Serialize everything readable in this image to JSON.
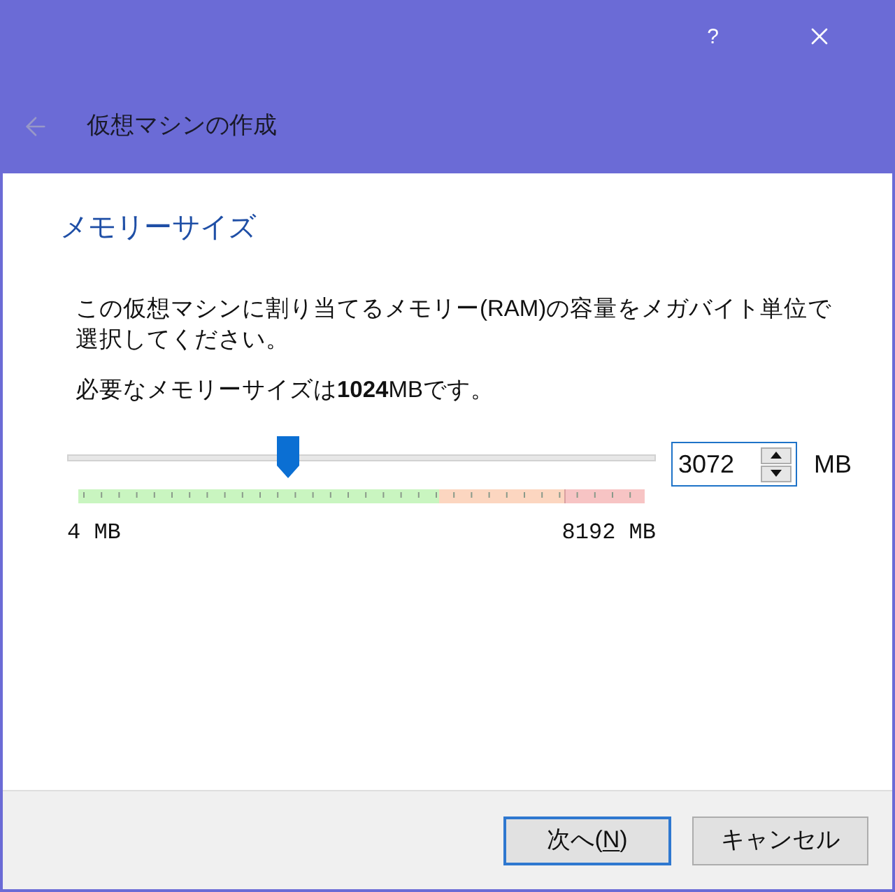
{
  "title_bar": {
    "help_label": "?"
  },
  "header": {
    "back_button": {
      "disabled": true
    },
    "title": "仮想マシンの作成"
  },
  "page": {
    "heading": "メモリーサイズ",
    "description": "この仮想マシンに割り当てるメモリー(RAM)の容量をメガバイト単位で選択してください。",
    "recommendation": "必要なメモリーサイズは**1024**MBです。"
  },
  "memory": {
    "slider": {
      "level": 0.375
    },
    "min_label": "4 MB",
    "max_label": "8192 MB",
    "value": "3072",
    "unit": "MB"
  },
  "buttons": [
    {
      "label_parts": [
        {
          "text": "次へ(",
          "mnemonic": false
        },
        {
          "text": "N",
          "mnemonic": true
        },
        {
          "text": ")",
          "mnemonic": false
        }
      ],
      "default": true
    },
    {
      "label_parts": [
        {
          "text": "キャンセル",
          "mnemonic": false
        }
      ],
      "default": false
    }
  ]
}
